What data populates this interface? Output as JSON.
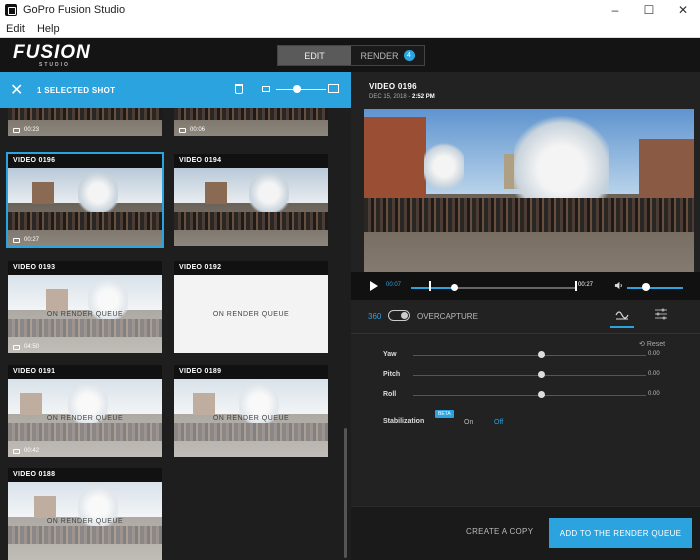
{
  "window": {
    "title": "GoPro Fusion Studio",
    "controls": [
      "–",
      "☐",
      "✕"
    ]
  },
  "menu": {
    "items": [
      "Edit",
      "Help"
    ]
  },
  "header": {
    "logo": "FUSION",
    "logo_sub": "STUDIO",
    "modes": {
      "edit": "EDIT",
      "render": "RENDER",
      "render_count": "4"
    }
  },
  "selection_bar": {
    "close_icon": "✕",
    "label": "1 SELECTED SHOT"
  },
  "clips": [
    {
      "title": "",
      "duration": "00:23",
      "overlay": ""
    },
    {
      "title": "",
      "duration": "00:06",
      "overlay": ""
    },
    {
      "title": "VIDEO 0196",
      "duration": "00:27",
      "overlay": "",
      "selected": true
    },
    {
      "title": "VIDEO 0194",
      "duration": "",
      "overlay": ""
    },
    {
      "title": "VIDEO 0193",
      "duration": "04:50",
      "overlay": "ON RENDER QUEUE"
    },
    {
      "title": "VIDEO 0192",
      "duration": "",
      "overlay": "ON RENDER QUEUE"
    },
    {
      "title": "VIDEO 0191",
      "duration": "00:42",
      "overlay": "ON RENDER QUEUE"
    },
    {
      "title": "VIDEO 0189",
      "duration": "",
      "overlay": "ON RENDER QUEUE"
    },
    {
      "title": "VIDEO 0188",
      "duration": "",
      "overlay": "ON RENDER QUEUE"
    }
  ],
  "preview": {
    "title": "VIDEO 0196",
    "date": "DEC 15, 2018 -",
    "time": "2:52 PM",
    "current_time": "00:07",
    "end_time": "00:27",
    "progress": 0.26,
    "volume": 0.3
  },
  "view_toggle": {
    "left": "360",
    "right": "OVERCAPTURE"
  },
  "adjust": {
    "reset": "Reset",
    "sliders": [
      {
        "label": "Yaw",
        "value": "0.00"
      },
      {
        "label": "Pitch",
        "value": "0.00"
      },
      {
        "label": "Roll",
        "value": "0.00"
      }
    ],
    "stabilization": {
      "label": "Stabilization",
      "beta": "BETA",
      "on": "On",
      "off": "Off"
    }
  },
  "footer": {
    "create_copy": "CREATE A COPY",
    "add_queue": "ADD TO THE RENDER QUEUE"
  },
  "colors": {
    "accent": "#2aa3df"
  }
}
